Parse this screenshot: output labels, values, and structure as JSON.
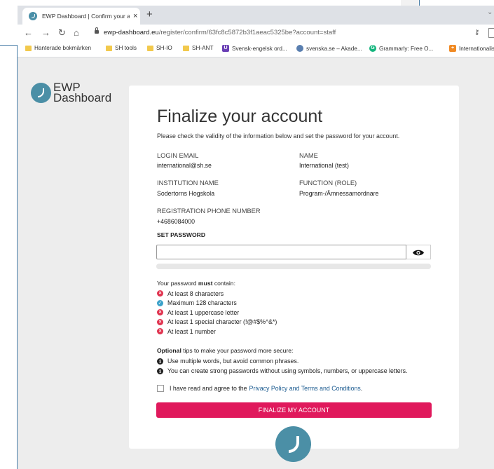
{
  "browser": {
    "tab_title": "EWP Dashboard | Confirm your a",
    "tab_close": "×",
    "new_tab": "+",
    "url_host": "ewp-dashboard.eu",
    "url_path": "/register/confirm/63fc8c5872b3f1aeac5325be?account=staff",
    "bookmarks": [
      {
        "label": "Hanterade bokmärken",
        "icon": "folder-icon"
      },
      {
        "label": "SH tools",
        "icon": "folder-icon"
      },
      {
        "label": "SH-IO",
        "icon": "folder-icon"
      },
      {
        "label": "SH-ANT",
        "icon": "folder-icon"
      },
      {
        "label": "Svensk-engelsk ord...",
        "icon": "dictionary-icon"
      },
      {
        "label": "svenska.se – Akade...",
        "icon": "globe-icon"
      },
      {
        "label": "Grammarly: Free O...",
        "icon": "grammarly-icon"
      },
      {
        "label": "Internationalise",
        "icon": "plus-brand-icon"
      }
    ]
  },
  "logo": {
    "line1": "EWP",
    "line2": "Dashboard"
  },
  "form": {
    "title": "Finalize your account",
    "subtitle": "Please check the validity of the information below and set the password for your account.",
    "fields": {
      "login_email": {
        "label": "LOGIN EMAIL",
        "value": "international@sh.se"
      },
      "name": {
        "label": "NAME",
        "value": "International (test)"
      },
      "institution": {
        "label": "INSTITUTION NAME",
        "value": "Sodertorns Hogskola"
      },
      "function": {
        "label": "FUNCTION (ROLE)",
        "value": "Program-/Ämnessamordnare"
      },
      "phone": {
        "label": "REGISTRATION PHONE NUMBER",
        "value": "+4686084000"
      }
    },
    "set_password_label": "SET PASSWORD",
    "password_value": "",
    "requirements_intro_pre": "Your password ",
    "requirements_intro_bold": "must",
    "requirements_intro_post": " contain:",
    "requirements": [
      {
        "text": "At least 8 characters",
        "status": "fail"
      },
      {
        "text": "Maximum 128 characters",
        "status": "ok"
      },
      {
        "text": "At least 1 uppercase letter",
        "status": "fail"
      },
      {
        "text": "At least 1 special character (!@#$%^&*)",
        "status": "fail"
      },
      {
        "text": "At least 1 number",
        "status": "fail"
      }
    ],
    "tips_intro_bold": "Optional",
    "tips_intro_post": " tips to make your password more secure:",
    "tips": [
      "Use multiple words, but avoid common phrases.",
      "You can create strong passwords without using symbols, numbers, or uppercase letters."
    ],
    "agree_text": "I have read and agree to the",
    "agree_link": "Privacy Policy and Terms and Conditions",
    "agree_end": ".",
    "submit_label": "FINALIZE MY ACCOUNT"
  },
  "colors": {
    "accent": "#e0195c",
    "brand": "#4b8fa6",
    "fail": "#e0334f",
    "ok": "#3aa1c9"
  }
}
